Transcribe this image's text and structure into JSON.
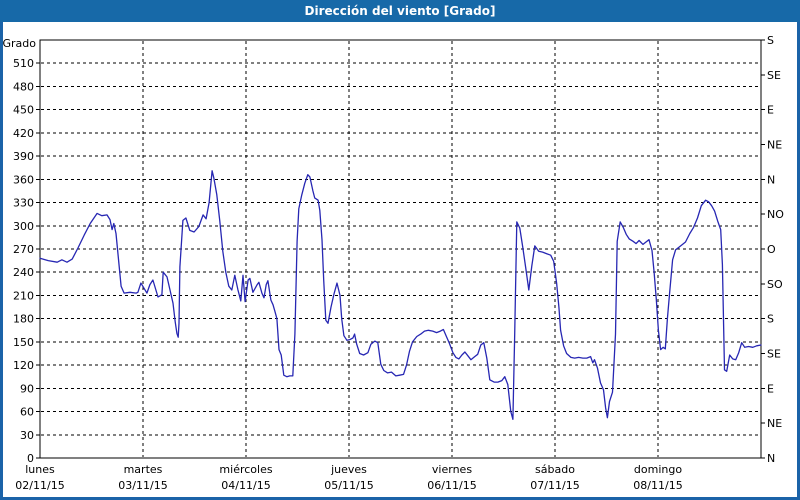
{
  "window": {
    "title": "Dirección del viento [Grado]"
  },
  "colors": {
    "title_bar": "#1769a8",
    "frame_border": "#1b63a8",
    "line": "#2727b3",
    "grid": "#000000",
    "background": "#ffffff"
  },
  "y_axis_left": {
    "label": "Grado",
    "min": 0,
    "max": 540,
    "tick_step": 30,
    "tick_labels": [
      "510",
      "480",
      "450",
      "420",
      "390",
      "360",
      "330",
      "300",
      "270",
      "240",
      "210",
      "180",
      "150",
      "120",
      "90",
      "60",
      "30",
      "0"
    ]
  },
  "y_axis_right": {
    "tick_step_degrees": 45,
    "labels_top_to_bottom": [
      "S",
      "SE",
      "E",
      "NE",
      "N",
      "NO",
      "O",
      "SO",
      "S",
      "SE",
      "E",
      "NE",
      "N"
    ]
  },
  "x_axis": {
    "days": [
      {
        "name": "lunes",
        "date": "02/11/15"
      },
      {
        "name": "martes",
        "date": "03/11/15"
      },
      {
        "name": "miércoles",
        "date": "04/11/15"
      },
      {
        "name": "jueves",
        "date": "05/11/15"
      },
      {
        "name": "viernes",
        "date": "06/11/15"
      },
      {
        "name": "sábado",
        "date": "07/11/15"
      },
      {
        "name": "domingo",
        "date": "08/11/15"
      }
    ]
  },
  "chart_data": {
    "type": "line",
    "title": "Dirección del viento [Grado]",
    "xlabel": "",
    "ylabel": "Grado",
    "ylim": [
      0,
      540
    ],
    "x_unit": "hours_since_monday_00:00",
    "xlim": [
      0,
      168
    ],
    "grid": "dashed",
    "legend_position": "none",
    "series": [
      {
        "name": "wind_direction_degrees",
        "color": "#2727b3",
        "points": [
          [
            0,
            258
          ],
          [
            1.9,
            255
          ],
          [
            4,
            253
          ],
          [
            5.1,
            256
          ],
          [
            6.3,
            253
          ],
          [
            7.5,
            257
          ],
          [
            8.9,
            272
          ],
          [
            10.3,
            288
          ],
          [
            11.7,
            303
          ],
          [
            13.3,
            316
          ],
          [
            14.4,
            313
          ],
          [
            15.6,
            314
          ],
          [
            16.3,
            308
          ],
          [
            16.8,
            295
          ],
          [
            17.2,
            303
          ],
          [
            17.7,
            290
          ],
          [
            18.4,
            250
          ],
          [
            18.9,
            222
          ],
          [
            19.6,
            213
          ],
          [
            21,
            214
          ],
          [
            22.4,
            213
          ],
          [
            22.8,
            214
          ],
          [
            23.5,
            226
          ],
          [
            24.9,
            213
          ],
          [
            25.6,
            224
          ],
          [
            26.3,
            230
          ],
          [
            27.5,
            208
          ],
          [
            28.4,
            211
          ],
          [
            28.7,
            240
          ],
          [
            29.6,
            234
          ],
          [
            30.3,
            217
          ],
          [
            31,
            200
          ],
          [
            31.5,
            176
          ],
          [
            31.9,
            161
          ],
          [
            32.2,
            156
          ],
          [
            32.4,
            174
          ],
          [
            32.6,
            247
          ],
          [
            33.3,
            307
          ],
          [
            34,
            310
          ],
          [
            34.9,
            294
          ],
          [
            35.9,
            292
          ],
          [
            37,
            299
          ],
          [
            38,
            314
          ],
          [
            38.7,
            309
          ],
          [
            39.4,
            330
          ],
          [
            40.1,
            371
          ],
          [
            40.5,
            362
          ],
          [
            41.2,
            340
          ],
          [
            41.9,
            306
          ],
          [
            42.6,
            267
          ],
          [
            43.3,
            240
          ],
          [
            44,
            222
          ],
          [
            44.7,
            217
          ],
          [
            45.4,
            236
          ],
          [
            46.1,
            218
          ],
          [
            46.8,
            203
          ],
          [
            47.3,
            236
          ],
          [
            47.8,
            202
          ],
          [
            48.5,
            230
          ],
          [
            48.9,
            232
          ],
          [
            49.6,
            214
          ],
          [
            50.6,
            224
          ],
          [
            51,
            227
          ],
          [
            51.7,
            213
          ],
          [
            52.2,
            207
          ],
          [
            52.7,
            224
          ],
          [
            53.1,
            229
          ],
          [
            53.8,
            204
          ],
          [
            54.3,
            198
          ],
          [
            54.7,
            190
          ],
          [
            55.2,
            180
          ],
          [
            55.7,
            140
          ],
          [
            56.2,
            133
          ],
          [
            56.8,
            107
          ],
          [
            57.5,
            105
          ],
          [
            58.2,
            106
          ],
          [
            58.9,
            106
          ],
          [
            59.4,
            160
          ],
          [
            59.9,
            280
          ],
          [
            60.3,
            322
          ],
          [
            61,
            340
          ],
          [
            61.7,
            355
          ],
          [
            62.4,
            366
          ],
          [
            62.9,
            363
          ],
          [
            63.6,
            345
          ],
          [
            64,
            336
          ],
          [
            64.8,
            333
          ],
          [
            65.2,
            320
          ],
          [
            65.7,
            282
          ],
          [
            66.1,
            230
          ],
          [
            66.6,
            178
          ],
          [
            67.1,
            174
          ],
          [
            67.8,
            195
          ],
          [
            68.5,
            212
          ],
          [
            69.2,
            226
          ],
          [
            69.9,
            210
          ],
          [
            70.3,
            180
          ],
          [
            70.8,
            158
          ],
          [
            71.5,
            152
          ],
          [
            72.2,
            153
          ],
          [
            72.9,
            155
          ],
          [
            73.3,
            160
          ],
          [
            73.8,
            147
          ],
          [
            74.5,
            135
          ],
          [
            75.4,
            133
          ],
          [
            76.4,
            136
          ],
          [
            77.1,
            147
          ],
          [
            78,
            151
          ],
          [
            78.7,
            149
          ],
          [
            79.4,
            121
          ],
          [
            80.1,
            113
          ],
          [
            81,
            110
          ],
          [
            81.9,
            111
          ],
          [
            82.9,
            106
          ],
          [
            83.8,
            107
          ],
          [
            84.7,
            108
          ],
          [
            85.4,
            120
          ],
          [
            86.1,
            138
          ],
          [
            86.8,
            150
          ],
          [
            87.8,
            157
          ],
          [
            88.7,
            160
          ],
          [
            89.6,
            164
          ],
          [
            90.5,
            165
          ],
          [
            91.5,
            164
          ],
          [
            92.4,
            162
          ],
          [
            93.3,
            164
          ],
          [
            94,
            166
          ],
          [
            94.7,
            157
          ],
          [
            95.4,
            148
          ],
          [
            96.2,
            136
          ],
          [
            96.9,
            130
          ],
          [
            97.6,
            128
          ],
          [
            98.3,
            133
          ],
          [
            99,
            137
          ],
          [
            99.7,
            132
          ],
          [
            100.4,
            127
          ],
          [
            101.3,
            131
          ],
          [
            102,
            134
          ],
          [
            102.7,
            146
          ],
          [
            103.4,
            149
          ],
          [
            104.1,
            129
          ],
          [
            104.8,
            101
          ],
          [
            105.8,
            98
          ],
          [
            106.7,
            98
          ],
          [
            107.6,
            100
          ],
          [
            108.3,
            105
          ],
          [
            109,
            95
          ],
          [
            109.7,
            60
          ],
          [
            110.2,
            50
          ],
          [
            110.6,
            160
          ],
          [
            111.1,
            305
          ],
          [
            111.8,
            297
          ],
          [
            112.5,
            272
          ],
          [
            113.2,
            245
          ],
          [
            113.9,
            217
          ],
          [
            114.6,
            248
          ],
          [
            115.3,
            274
          ],
          [
            116.2,
            267
          ],
          [
            117.1,
            266
          ],
          [
            118,
            264
          ],
          [
            119,
            262
          ],
          [
            119.7,
            254
          ],
          [
            120.4,
            225
          ],
          [
            120.9,
            195
          ],
          [
            121.3,
            165
          ],
          [
            122,
            145
          ],
          [
            122.7,
            135
          ],
          [
            123.7,
            130
          ],
          [
            124.6,
            129
          ],
          [
            125.5,
            130
          ],
          [
            126.5,
            129
          ],
          [
            127.4,
            129
          ],
          [
            128.3,
            131
          ],
          [
            128.8,
            123
          ],
          [
            129.2,
            127
          ],
          [
            129.9,
            116
          ],
          [
            130.6,
            97
          ],
          [
            131.3,
            88
          ],
          [
            131.8,
            65
          ],
          [
            132.2,
            52
          ],
          [
            132.7,
            73
          ],
          [
            133.4,
            85
          ],
          [
            134.1,
            160
          ],
          [
            134.5,
            280
          ],
          [
            135.2,
            305
          ],
          [
            135.9,
            298
          ],
          [
            136.6,
            289
          ],
          [
            137.3,
            283
          ],
          [
            138.2,
            280
          ],
          [
            138.9,
            277
          ],
          [
            139.6,
            281
          ],
          [
            140.5,
            276
          ],
          [
            141.2,
            279
          ],
          [
            141.9,
            282
          ],
          [
            142.6,
            268
          ],
          [
            143.1,
            240
          ],
          [
            143.6,
            205
          ],
          [
            144.1,
            165
          ],
          [
            144.6,
            140
          ],
          [
            145.2,
            143
          ],
          [
            145.7,
            141
          ],
          [
            146.2,
            180
          ],
          [
            146.7,
            213
          ],
          [
            147.4,
            256
          ],
          [
            148.1,
            269
          ],
          [
            148.8,
            272
          ],
          [
            149.5,
            275
          ],
          [
            150.4,
            279
          ],
          [
            151.4,
            290
          ],
          [
            152.3,
            298
          ],
          [
            153.2,
            310
          ],
          [
            154.1,
            326
          ],
          [
            155.1,
            333
          ],
          [
            155.8,
            331
          ],
          [
            156.5,
            326
          ],
          [
            157.2,
            319
          ],
          [
            157.9,
            306
          ],
          [
            158.6,
            295
          ],
          [
            159,
            250
          ],
          [
            159.5,
            114
          ],
          [
            160,
            112
          ],
          [
            160.7,
            133
          ],
          [
            161.4,
            128
          ],
          [
            162.1,
            127
          ],
          [
            162.8,
            136
          ],
          [
            163.5,
            149
          ],
          [
            164.2,
            143
          ],
          [
            165.1,
            144
          ],
          [
            166.1,
            143
          ],
          [
            167,
            145
          ],
          [
            168,
            146
          ]
        ]
      }
    ]
  }
}
